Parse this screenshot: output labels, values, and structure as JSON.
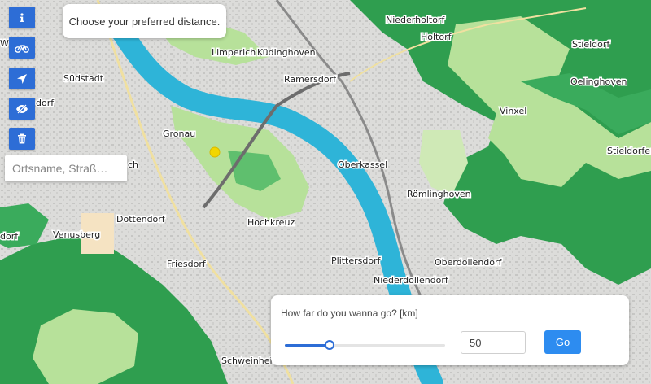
{
  "map": {
    "places": [
      "Niederholtorf",
      "Holtorf",
      "Stieldorf",
      "Südstadt",
      "Limperich",
      "Küdinghoven",
      "Oelinghoven",
      "Ramersdorf",
      "Vinxel",
      "dorf",
      "Gronau",
      "Stieldorferh",
      "Oberkassel",
      "Römlinghoven",
      "Dottendorf",
      "Hochkreuz",
      "Venusberg",
      "Friesdorf",
      "Plittersdorf",
      "Oberdollendorf",
      "Niederdollendorf",
      "Schweinheim",
      "dorf",
      "ch",
      "W"
    ],
    "colors": {
      "river": "#2eb4d8",
      "forest": "#2f9e4f",
      "meadow": "#b7e19a",
      "accent": "#2d6dd6",
      "marker": "#f2d600"
    }
  },
  "toolbar": {
    "buttons": [
      {
        "name": "info-button",
        "icon": "info-icon"
      },
      {
        "name": "bike-button",
        "icon": "bicycle-icon"
      },
      {
        "name": "locate-button",
        "icon": "location-arrow-icon"
      },
      {
        "name": "visibility-button",
        "icon": "eye-slash-icon"
      },
      {
        "name": "delete-button",
        "icon": "trash-icon"
      }
    ]
  },
  "search": {
    "placeholder": "Ortsname, Straß…"
  },
  "hint": {
    "text": "Choose your preferred distance."
  },
  "distance_panel": {
    "label": "How far do you wanna go? [km]",
    "value": "50",
    "slider_fraction": 0.28,
    "go_label": "Go"
  }
}
